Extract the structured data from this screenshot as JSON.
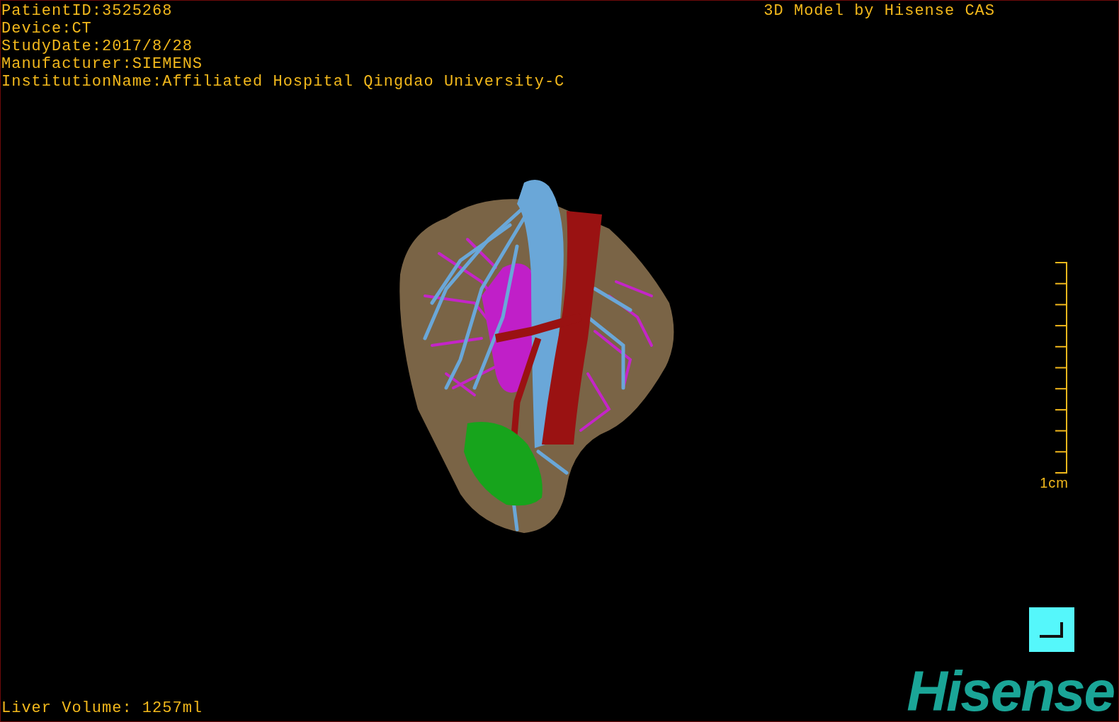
{
  "patient_info": [
    "PatientID:3525268",
    "Device:CT",
    "StudyDate:2017/8/28",
    "Manufacturer:SIEMENS",
    "InstitutionName:Affiliated Hospital Qingdao University-C"
  ],
  "title": "3D Model by Hisense CAS",
  "scale_bar": {
    "label": "1cm"
  },
  "liver_volume": "Liver Volume: 1257ml",
  "logo": "Hisense"
}
